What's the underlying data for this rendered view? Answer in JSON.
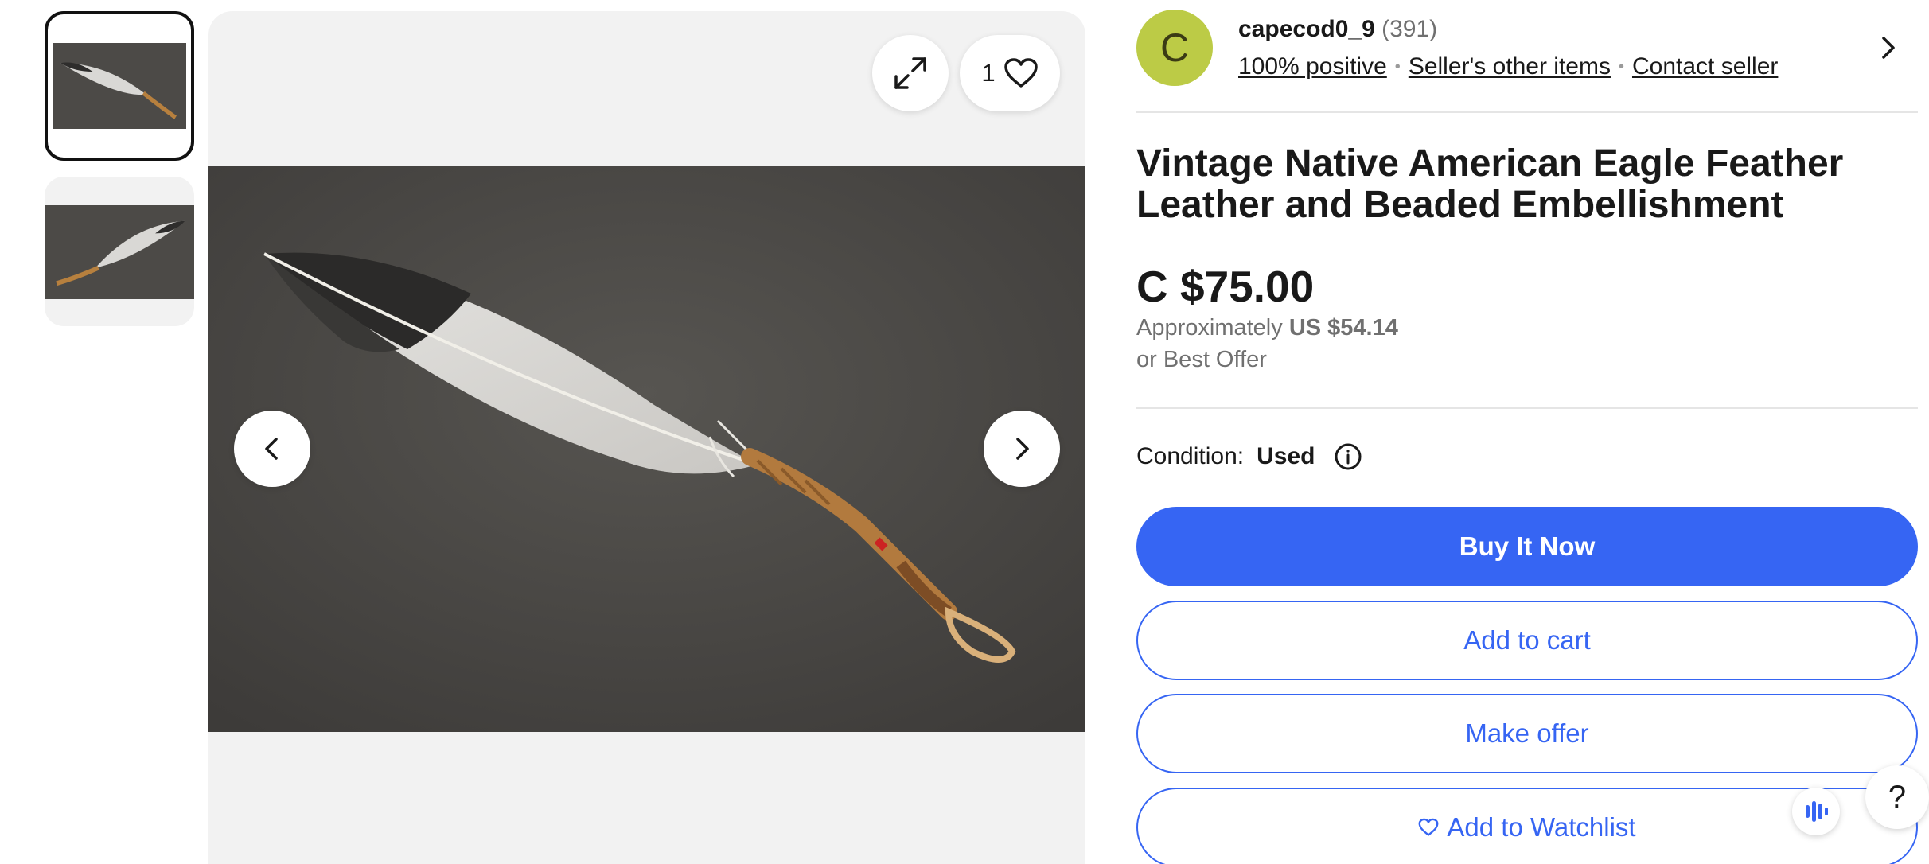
{
  "seller": {
    "avatar_letter": "C",
    "name": "capecod0_9",
    "feedback_count": "(391)",
    "positive": "100% positive",
    "other_items": "Seller's other items",
    "contact": "Contact seller"
  },
  "listing": {
    "title": "Vintage Native American Eagle Feather Leather and Beaded Embellishment",
    "price": "C $75.00",
    "approx_label": "Approximately",
    "approx_value": "US $54.14",
    "best_offer": "or Best Offer"
  },
  "condition": {
    "label": "Condition:",
    "value": "Used"
  },
  "gallery": {
    "like_count": "1",
    "image_count": 2,
    "selected_index": 1
  },
  "actions": {
    "buy_now": "Buy It Now",
    "add_to_cart": "Add to cart",
    "make_offer": "Make offer",
    "watchlist": "Add to Watchlist"
  },
  "help": {
    "label": "?"
  },
  "colors": {
    "primary": "#3665f3",
    "avatar_bg": "#bccb46",
    "text": "#191919",
    "muted": "#707070"
  }
}
